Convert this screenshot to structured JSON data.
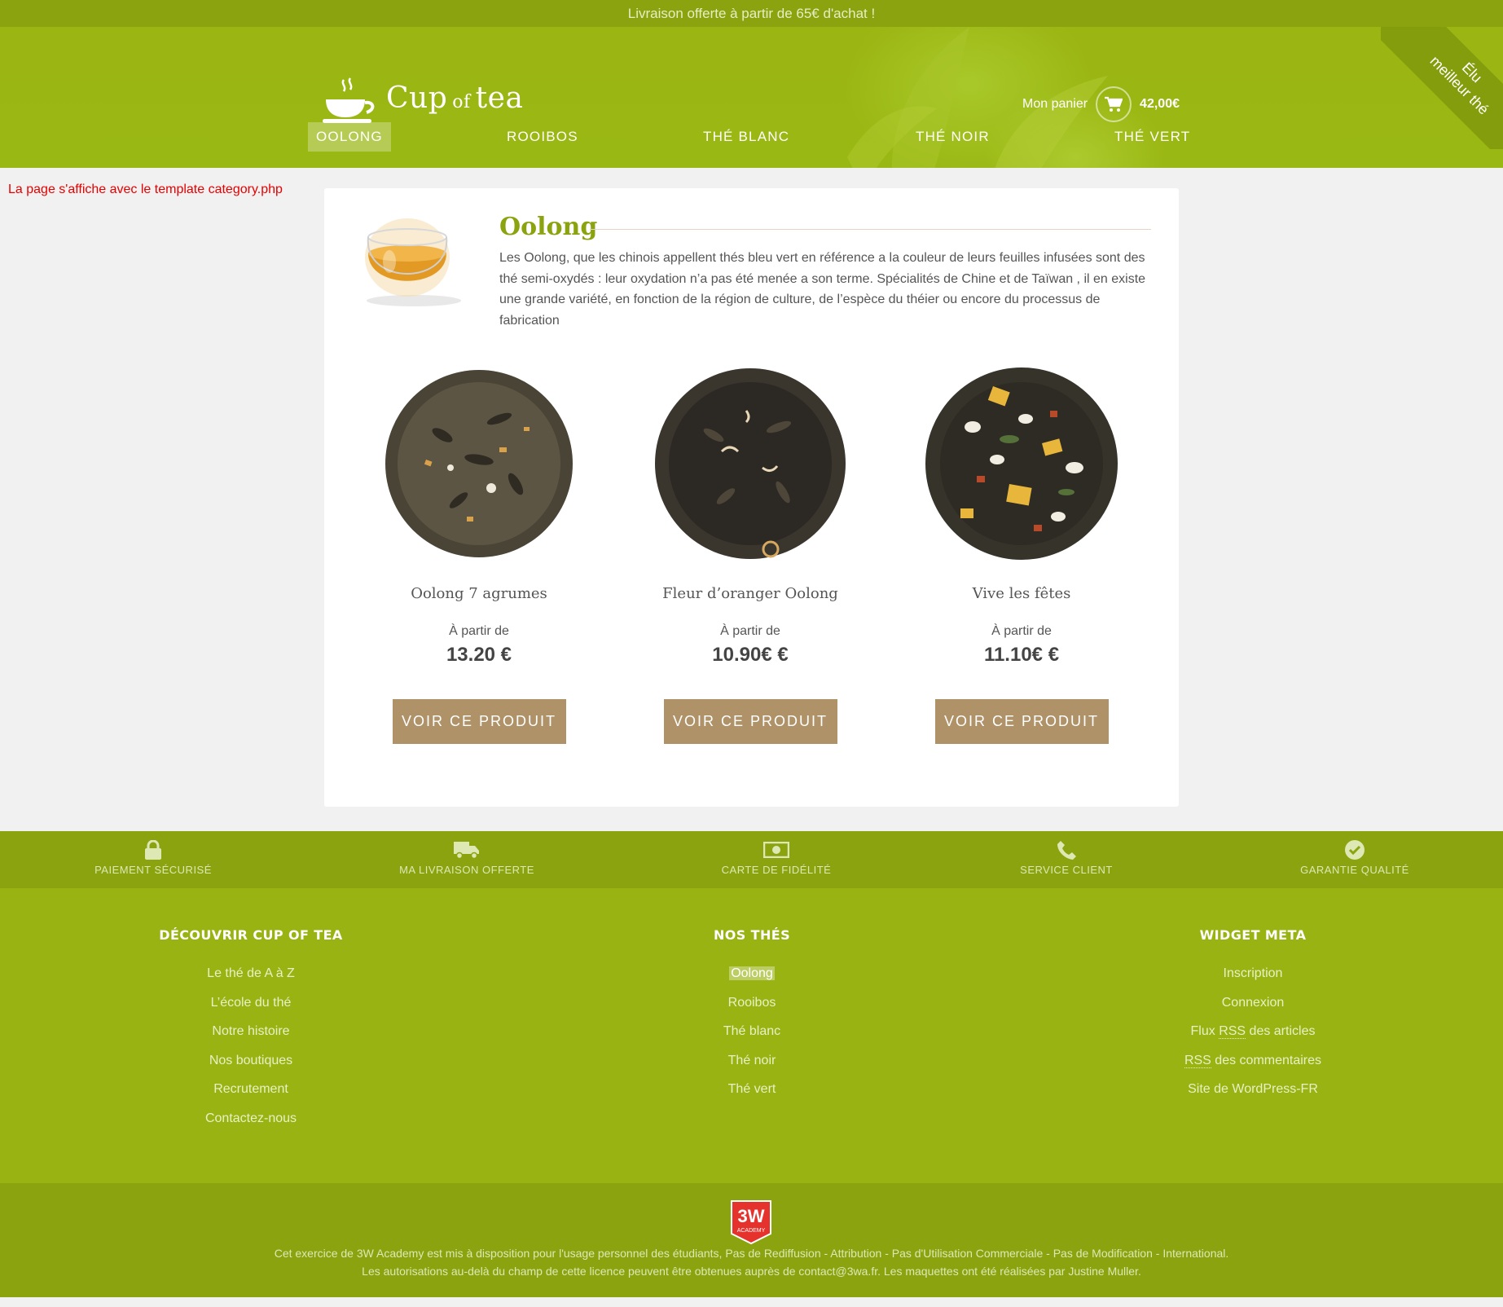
{
  "topbar": {
    "text": "Livraison offerte à partir de 65€ d'achat !"
  },
  "corner_ribbon": {
    "line1": "Élu",
    "line2": "meilleur thé"
  },
  "logo": {
    "word1": "Cup",
    "word2": "of",
    "word3": "tea"
  },
  "cart": {
    "label": "Mon panier",
    "amount": "42,00€"
  },
  "nav": [
    {
      "label": "OOLONG",
      "active": true
    },
    {
      "label": "ROOIBOS",
      "active": false
    },
    {
      "label": "THÉ BLANC",
      "active": false
    },
    {
      "label": "THÉ NOIR",
      "active": false
    },
    {
      "label": "THÉ VERT",
      "active": false
    }
  ],
  "notice": "La page s'affiche avec le template category.php",
  "category": {
    "title": "Oolong",
    "description": "Les Oolong, que les chinois appellent thés bleu vert en référence a la couleur de leurs feuilles infusées sont des thé semi-oxydés : leur oxydation n’a pas été menée a son terme. Spécialités de Chine et de Taïwan , il en existe une grande variété, en fonction de la région de culture, de l’espèce du théier ou encore du processus de fabrication"
  },
  "products": [
    {
      "name": "Oolong 7 agrumes",
      "from": "À partir de",
      "price": "13.20 €",
      "button": "VOIR CE PRODUIT"
    },
    {
      "name": "Fleur d’oranger Oolong",
      "from": "À partir de",
      "price": "10.90€ €",
      "button": "VOIR CE PRODUIT"
    },
    {
      "name": "Vive les fêtes",
      "from": "À partir de",
      "price": "11.10€ €",
      "button": "VOIR CE PRODUIT"
    }
  ],
  "features": [
    {
      "label": "PAIEMENT SÉCURISÉ",
      "icon": "lock-icon"
    },
    {
      "label": "MA LIVRAISON OFFERTE",
      "icon": "truck-icon"
    },
    {
      "label": "CARTE DE FIDÉLITÉ",
      "icon": "banknote-icon"
    },
    {
      "label": "SERVICE CLIENT",
      "icon": "phone-icon"
    },
    {
      "label": "GARANTIE QUALITÉ",
      "icon": "check-circle-icon"
    }
  ],
  "footer": {
    "col1": {
      "title": "DÉCOUVRIR CUP OF TEA",
      "links": [
        "Le thé de A à Z",
        "L’école du thé",
        "Notre histoire",
        "Nos boutiques",
        "Recrutement",
        "Contactez-nous"
      ]
    },
    "col2": {
      "title": "NOS THÉS",
      "links": [
        "Oolong",
        "Rooibos",
        "Thé blanc",
        "Thé noir",
        "Thé vert"
      ]
    },
    "col3": {
      "title": "WIDGET META",
      "links": [
        "Inscription",
        "Connexion"
      ],
      "rss_articles": {
        "pre": "Flux ",
        "abbr": "RSS",
        "post": " des articles"
      },
      "rss_comments": {
        "abbr": "RSS",
        "post": " des commentaires"
      },
      "wp": "Site de WordPress-FR"
    }
  },
  "badge": {
    "line1": "3W",
    "line2": "ACADEMY"
  },
  "legal": {
    "line1": "Cet exercice de 3W Academy est mis à disposition pour l'usage personnel des étudiants, Pas de Rediffusion - Attribution - Pas d'Utilisation Commerciale - Pas de Modification - International.",
    "line2": "Les autorisations au-delà du champ de cette licence peuvent être obtenues auprès de contact@3wa.fr. Les maquettes ont été réalisées par Justine Muller."
  },
  "colors": {
    "green": "#98b312",
    "dark_green": "#8aa30f",
    "button": "#b09269",
    "notice": "#e60000"
  }
}
